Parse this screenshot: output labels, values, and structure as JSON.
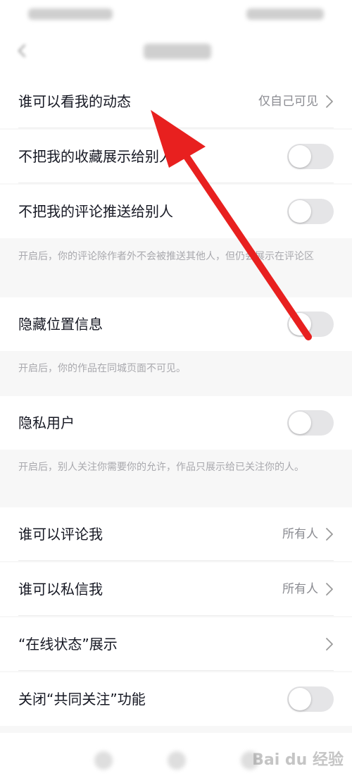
{
  "settings": {
    "who_can_see_activity": {
      "label": "谁可以看我的动态",
      "value": "仅自己可见"
    },
    "hide_favorites": {
      "label": "不把我的收藏展示给别人",
      "enabled": false
    },
    "hide_comments_push": {
      "label": "不把我的评论推送给别人",
      "enabled": false
    },
    "hide_comments_hint": "开启后，你的评论除作者外不会被推送其他人，但仍会展示在评论区",
    "hide_location": {
      "label": "隐藏位置信息",
      "enabled": false
    },
    "hide_location_hint": "开启后，你的作品在同城页面不可见。",
    "private_user": {
      "label": "隐私用户",
      "enabled": false
    },
    "private_user_hint": "开启后，别人关注你需要你的允许，作品只展示给已关注你的人。",
    "who_can_comment": {
      "label": "谁可以评论我",
      "value": "所有人"
    },
    "who_can_message": {
      "label": "谁可以私信我",
      "value": "所有人"
    },
    "online_status": {
      "label": "“在线状态”展示"
    },
    "close_mutual_follow": {
      "label": "关闭“共同关注”功能",
      "enabled": false
    }
  },
  "watermark": "Bai du 经验",
  "colors": {
    "arrow": "#e8201f",
    "toggle_off": "#e5e5e7",
    "text_primary": "#161823",
    "text_secondary": "#8a8b91",
    "hint_text": "#a9a9ae",
    "background": "#f7f7f7"
  },
  "icons": {
    "back": "chevron-left-icon",
    "row_chevron": "chevron-right-icon"
  }
}
